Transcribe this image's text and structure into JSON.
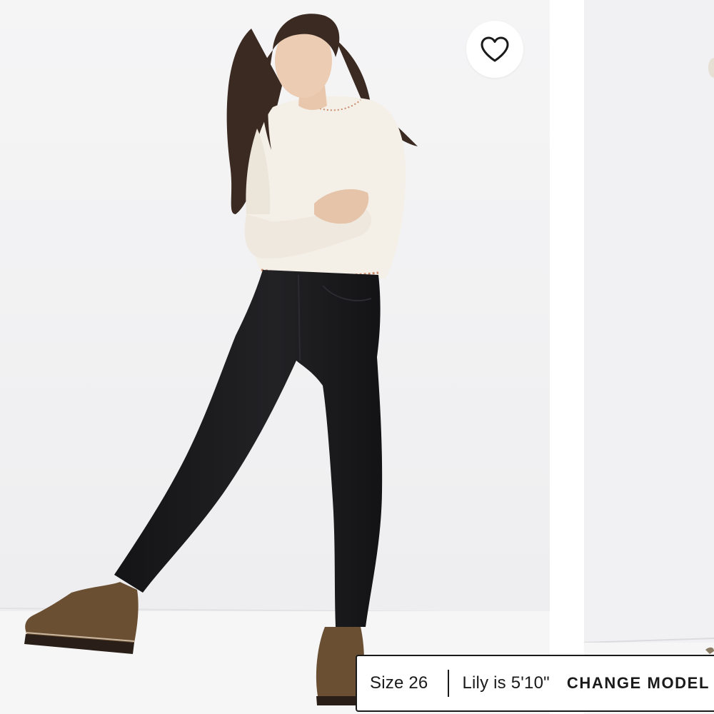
{
  "gallery": {
    "main_image_alt": "",
    "next_image_alt": "",
    "favorite_icon": "heart-outline-icon"
  },
  "model_bar": {
    "size_label": "Size 26",
    "height_label": "Lily is 5'10\"",
    "change_model_label": "CHANGE MODEL"
  },
  "colors": {
    "background": "#f1f1f3",
    "border": "#1a1a1a",
    "jeans": "#1b1b1d",
    "sweater": "#f4efe7",
    "boots": "#6a4f33"
  }
}
